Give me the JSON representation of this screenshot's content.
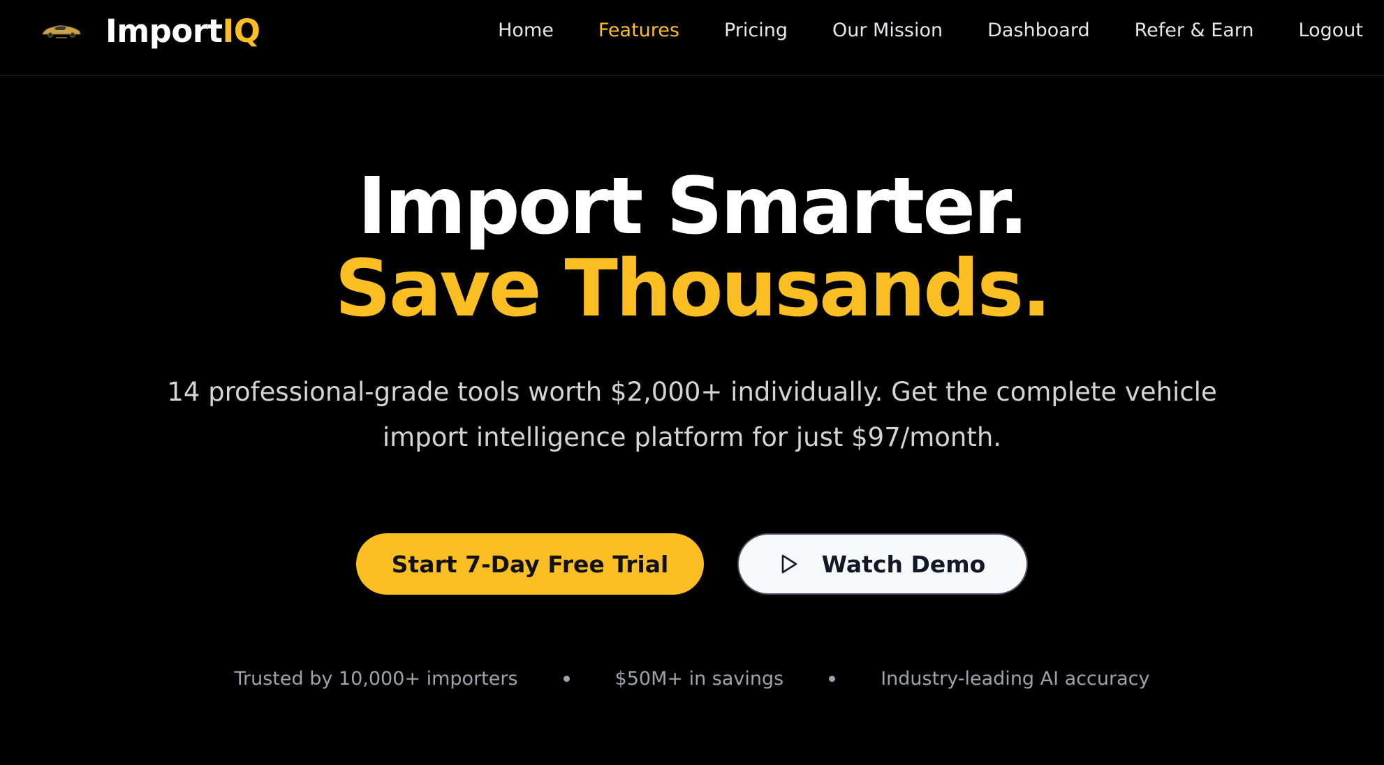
{
  "nav": {
    "brand_main": "Import",
    "brand_accent": "IQ",
    "links": [
      {
        "label": "Home"
      },
      {
        "label": "Features"
      },
      {
        "label": "Pricing"
      },
      {
        "label": "Our Mission"
      },
      {
        "label": "Dashboard"
      },
      {
        "label": "Refer & Earn"
      },
      {
        "label": "Logout"
      }
    ],
    "active_link": "Features"
  },
  "hero": {
    "headline_line1": "Import Smarter.",
    "headline_line2": "Save Thousands.",
    "subtext": "14 professional-grade tools worth $2,000+ individually. Get the complete vehicle import intelligence platform for just $97/month.",
    "primary_cta": "Start 7-Day Free Trial",
    "secondary_cta": "Watch Demo",
    "trust_items": [
      "Trusted by 10,000+ importers",
      "$50M+ in savings",
      "Industry-leading AI accuracy"
    ]
  },
  "icons": {
    "logo": "car-logo-icon",
    "demo": "play-icon"
  },
  "colors": {
    "background": "#000000",
    "accent": "#fbbf24",
    "text_primary": "#ffffff",
    "text_secondary": "#d4d4d8",
    "text_muted": "#9ca3af"
  }
}
